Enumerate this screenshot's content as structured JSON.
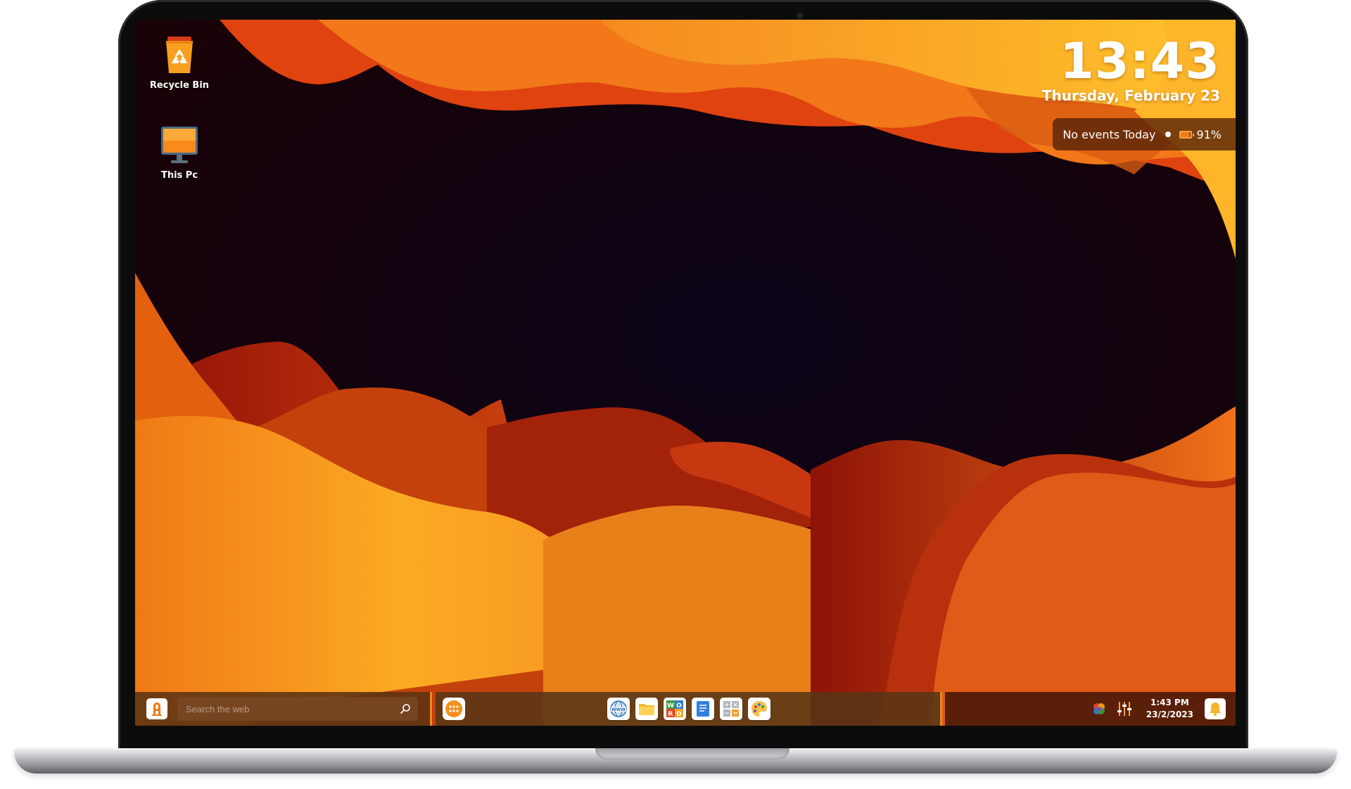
{
  "desktop": {
    "icons": [
      {
        "label": "Recycle Bin",
        "icon": "recycle-bin-icon"
      },
      {
        "label": "This Pc",
        "icon": "monitor-icon"
      }
    ]
  },
  "clock_widget": {
    "time": "13:43",
    "date": "Thursday, February 23",
    "events_text": "No events Today",
    "battery": "91%"
  },
  "taskbar": {
    "search_placeholder": "Search the web",
    "dock_apps": [
      "browser-icon",
      "file-explorer-icon",
      "word-icon",
      "notes-icon",
      "calculator-icon",
      "paint-icon"
    ],
    "tray": {
      "time": "1:43 PM",
      "date": "23/2/2023"
    }
  },
  "colors": {
    "accent": "#f28a1f",
    "wallpaper_dark": "#120208"
  }
}
